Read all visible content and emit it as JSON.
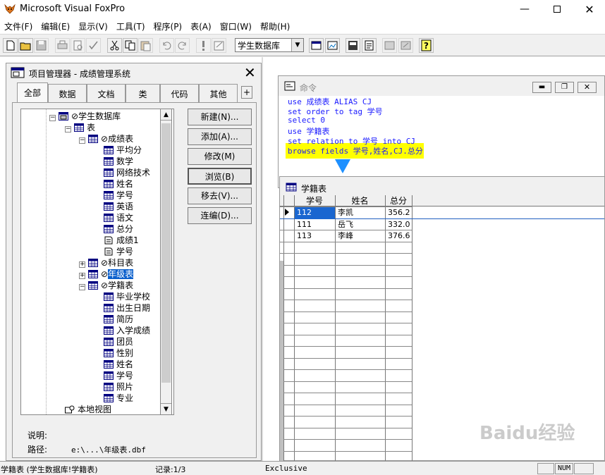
{
  "app": {
    "title": "Microsoft Visual FoxPro"
  },
  "menu": [
    "文件(F)",
    "编辑(E)",
    "显示(V)",
    "工具(T)",
    "程序(P)",
    "表(A)",
    "窗口(W)",
    "帮助(H)"
  ],
  "toolbar": {
    "database_select": "学生数据库"
  },
  "project_manager": {
    "title": "项目管理器 - 成绩管理系统",
    "tabs": [
      "全部",
      "数据",
      "文档",
      "类",
      "代码",
      "其他"
    ],
    "tab_overflow": "+",
    "tree": [
      {
        "label": "学生数据库",
        "level": 0,
        "expander": "⊟",
        "kind": "db"
      },
      {
        "label": "表",
        "level": 1,
        "expander": "⊟",
        "kind": "table"
      },
      {
        "label": "成绩表",
        "level": 2,
        "expander": "⊟",
        "kind": "table"
      },
      {
        "label": "平均分",
        "level": 3,
        "kind": "field"
      },
      {
        "label": "数学",
        "level": 3,
        "kind": "field"
      },
      {
        "label": "网络技术",
        "level": 3,
        "kind": "field"
      },
      {
        "label": "姓名",
        "level": 3,
        "kind": "field"
      },
      {
        "label": "学号",
        "level": 3,
        "kind": "field"
      },
      {
        "label": "英语",
        "level": 3,
        "kind": "field"
      },
      {
        "label": "语文",
        "level": 3,
        "kind": "field"
      },
      {
        "label": "总分",
        "level": 3,
        "kind": "field"
      },
      {
        "label": "成绩1",
        "level": 3,
        "kind": "index"
      },
      {
        "label": "学号",
        "level": 3,
        "kind": "index"
      },
      {
        "label": "科目表",
        "level": 2,
        "expander": "⊞",
        "kind": "table"
      },
      {
        "label": "年级表",
        "level": 2,
        "expander": "⊞",
        "kind": "table",
        "selected": true
      },
      {
        "label": "学籍表",
        "level": 2,
        "expander": "⊟",
        "kind": "table"
      },
      {
        "label": "毕业学校",
        "level": 3,
        "kind": "field"
      },
      {
        "label": "出生日期",
        "level": 3,
        "kind": "field"
      },
      {
        "label": "简历",
        "level": 3,
        "kind": "field"
      },
      {
        "label": "入学成绩",
        "level": 3,
        "kind": "field"
      },
      {
        "label": "团员",
        "level": 3,
        "kind": "field"
      },
      {
        "label": "性别",
        "level": 3,
        "kind": "field"
      },
      {
        "label": "姓名",
        "level": 3,
        "kind": "field"
      },
      {
        "label": "学号",
        "level": 3,
        "kind": "field"
      },
      {
        "label": "照片",
        "level": 3,
        "kind": "field"
      },
      {
        "label": "专业",
        "level": 3,
        "kind": "field"
      },
      {
        "label": "本地视图",
        "level": 1,
        "kind": "view"
      }
    ],
    "buttons": [
      "新建(N)...",
      "添加(A)...",
      "修改(M)",
      "浏览(B)",
      "移去(V)...",
      "连编(D)..."
    ],
    "desc_label": "说明:",
    "path_label": "路径:",
    "path_value": "e:\\...\\年级表.dbf"
  },
  "command_window": {
    "title": "命令",
    "lines": [
      "use 成绩表 ALIAS CJ",
      "set order to tag 学号",
      "select 0",
      "use 学籍表",
      "set relation to 学号 into CJ",
      "browse fields 学号,姓名,CJ.总分"
    ]
  },
  "browse_window": {
    "title": "学籍表",
    "columns": [
      "学号",
      "姓名",
      "总分"
    ],
    "rows": [
      [
        "112",
        "李凯",
        "356.2"
      ],
      [
        "111",
        "岳飞",
        "332.0"
      ],
      [
        "113",
        "李峰",
        "376.6"
      ]
    ]
  },
  "statusbar": {
    "table": "学籍表 (学生数据库!学籍表)",
    "record": "记录:1/3",
    "mode": "Exclusive",
    "num": "NUM"
  },
  "watermark": "Baidu经验"
}
